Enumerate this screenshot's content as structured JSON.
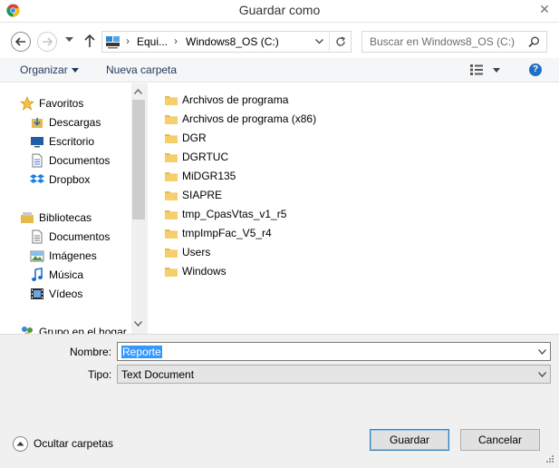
{
  "window": {
    "title": "Guardar como"
  },
  "address": {
    "crumbs": [
      "Equi...",
      "Windows8_OS (C:)"
    ],
    "search_placeholder": "Buscar en Windows8_OS (C:)"
  },
  "command_bar": {
    "organize_label": "Organizar",
    "new_folder_label": "Nueva carpeta"
  },
  "nav_pane": {
    "items": [
      {
        "label": "Favoritos",
        "icon": "star-icon"
      },
      {
        "label": "Descargas",
        "icon": "downloads-icon"
      },
      {
        "label": "Escritorio",
        "icon": "desktop-icon"
      },
      {
        "label": "Documentos",
        "icon": "documents-icon"
      },
      {
        "label": "Dropbox",
        "icon": "dropbox-icon"
      },
      {
        "label": "Bibliotecas",
        "icon": "libraries-icon"
      },
      {
        "label": "Documentos",
        "icon": "documents-icon"
      },
      {
        "label": "Imágenes",
        "icon": "pictures-icon"
      },
      {
        "label": "Música",
        "icon": "music-icon"
      },
      {
        "label": "Vídeos",
        "icon": "videos-icon"
      },
      {
        "label": "Grupo en el hogar",
        "icon": "homegroup-icon"
      }
    ]
  },
  "files": [
    "Archivos de programa",
    "Archivos de programa (x86)",
    "DGR",
    "DGRTUC",
    "MiDGR135",
    "SIAPRE",
    "tmp_CpasVtas_v1_r5",
    "tmpImpFac_V5_r4",
    "Users",
    "Windows"
  ],
  "form": {
    "name_label": "Nombre:",
    "name_value": "Reporte",
    "type_label": "Tipo:",
    "type_value": "Text Document"
  },
  "footer": {
    "hide_folders_label": "Ocultar carpetas",
    "save_label": "Guardar",
    "cancel_label": "Cancelar"
  },
  "colors": {
    "accent": "#1e395b",
    "selection": "#3399ff",
    "folder": "#e8b94a"
  }
}
